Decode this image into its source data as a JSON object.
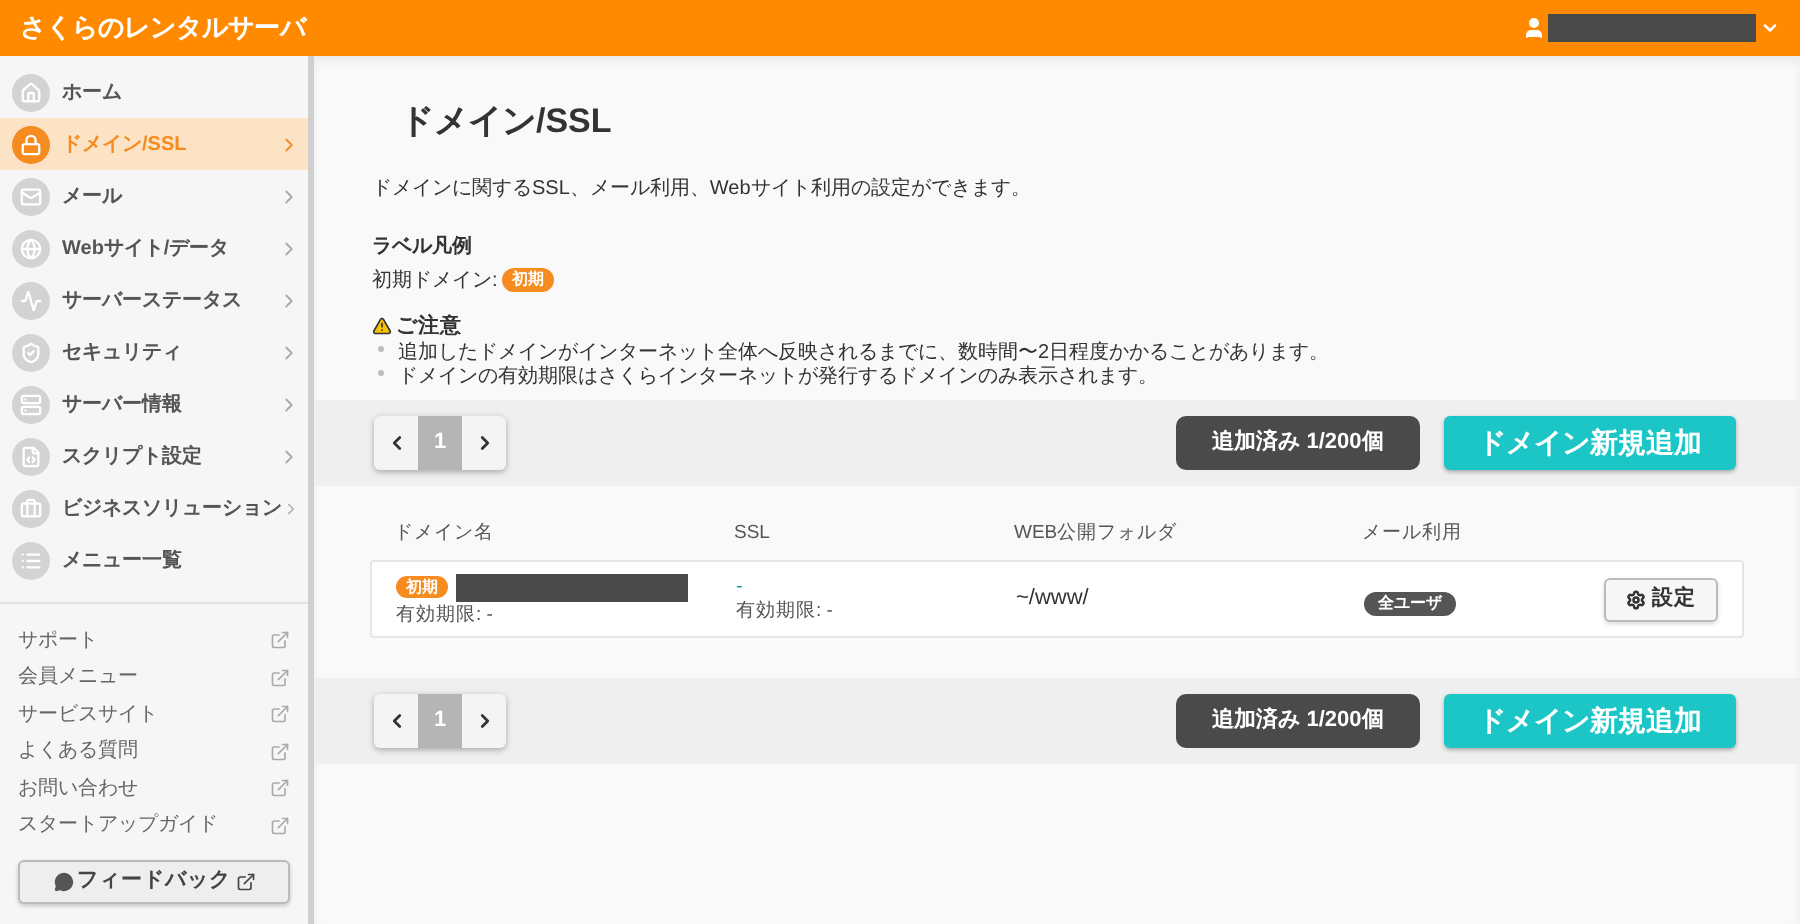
{
  "header": {
    "title": "さくらのレンタルサーバ"
  },
  "sidebar": {
    "items": [
      {
        "label": "ホーム",
        "selected": false,
        "arrow": false
      },
      {
        "label": "ドメイン/SSL",
        "selected": true,
        "arrow": true
      },
      {
        "label": "メール",
        "selected": false,
        "arrow": true
      },
      {
        "label": "Webサイト/データ",
        "selected": false,
        "arrow": true
      },
      {
        "label": "サーバーステータス",
        "selected": false,
        "arrow": true
      },
      {
        "label": "セキュリティ",
        "selected": false,
        "arrow": true
      },
      {
        "label": "サーバー情報",
        "selected": false,
        "arrow": true
      },
      {
        "label": "スクリプト設定",
        "selected": false,
        "arrow": true
      },
      {
        "label": "ビジネスソリューション",
        "selected": false,
        "arrow": true
      },
      {
        "label": "メニュー一覧",
        "selected": false,
        "arrow": false
      }
    ],
    "links": [
      "サポート",
      "会員メニュー",
      "サービスサイト",
      "よくある質問",
      "お問い合わせ",
      "スタートアップガイド"
    ],
    "feedback": "フィードバック"
  },
  "page": {
    "title": "ドメイン/SSL",
    "description": "ドメインに関するSSL、メール利用、Webサイト利用の設定ができます。",
    "legend": {
      "heading": "ラベル凡例",
      "label": "初期ドメイン:",
      "badge": "初期"
    },
    "notice": {
      "heading": "ご注意",
      "items": [
        "追加したドメインがインターネット全体へ反映されるまでに、数時間〜2日程度かかることがあります。",
        "ドメインの有効期限はさくらインターネットが発行するドメインのみ表示されます。"
      ]
    }
  },
  "toolbars": [
    {
      "pages": [
        {
          "label": "1",
          "selected": true
        }
      ],
      "count": "追加済み 1/200個",
      "add_button": "ドメイン新規追加"
    },
    {
      "pages": [
        {
          "label": "1",
          "selected": true
        }
      ],
      "count": "追加済み 1/200個",
      "add_button": "ドメイン新規追加"
    }
  ],
  "table": {
    "columns": [
      "ドメイン名",
      "SSL",
      "WEB公開フォルダ",
      "メール利用"
    ],
    "rows": [
      {
        "badge": "初期",
        "expiry": "有効期限: -",
        "ssl": "-",
        "ssl_expiry": "有効期限: -",
        "folder": "~/www/",
        "mail": "全ユーザ",
        "action": "設定"
      }
    ]
  }
}
